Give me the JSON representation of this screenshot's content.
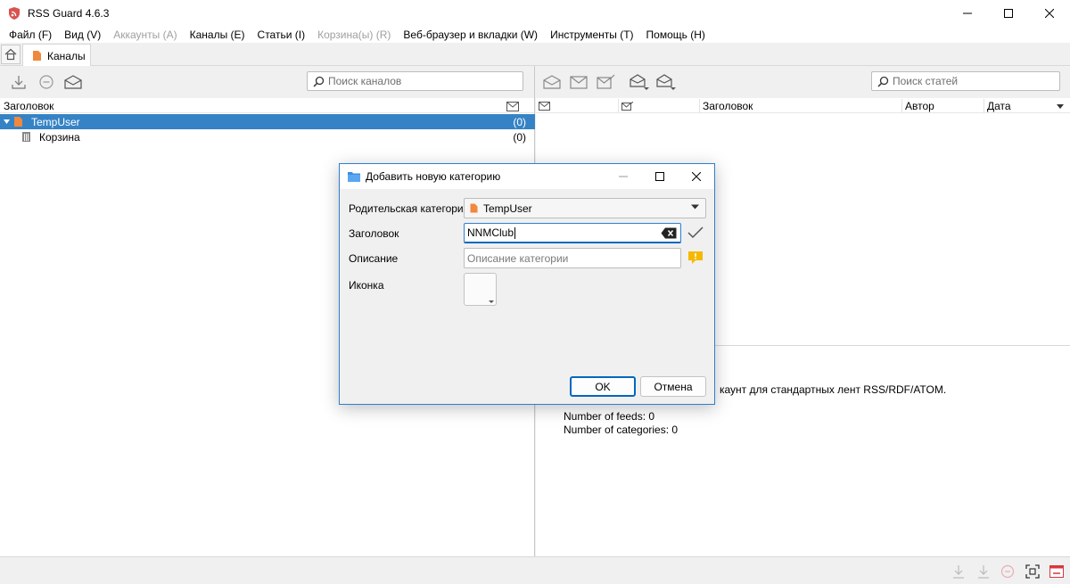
{
  "window": {
    "title": "RSS Guard 4.6.3"
  },
  "menu": [
    {
      "label": "Файл (F)",
      "enabled": true
    },
    {
      "label": "Вид (V)",
      "enabled": true
    },
    {
      "label": "Аккаунты (A)",
      "enabled": false
    },
    {
      "label": "Каналы (E)",
      "enabled": true
    },
    {
      "label": "Статьи (I)",
      "enabled": true
    },
    {
      "label": "Корзина(ы) (R)",
      "enabled": false
    },
    {
      "label": "Веб-браузер и вкладки (W)",
      "enabled": true
    },
    {
      "label": "Инструменты (T)",
      "enabled": true
    },
    {
      "label": "Помощь (H)",
      "enabled": true
    }
  ],
  "tabs": {
    "feeds_label": "Каналы"
  },
  "feeds_pane": {
    "search_placeholder": "Поиск каналов",
    "header_title": "Заголовок",
    "tree": [
      {
        "label": "TempUser",
        "count": "(0)",
        "selected": true
      },
      {
        "label": "Корзина",
        "count": "(0)",
        "selected": false
      }
    ]
  },
  "messages_pane": {
    "search_placeholder": "Поиск статей",
    "headers": {
      "title": "Заголовок",
      "author": "Автор",
      "date": "Дата"
    }
  },
  "preview": {
    "account_line": "каунт для стандартных лент RSS/RDF/ATOM.",
    "feeds_count": "Number of feeds: 0",
    "categories_count": "Number of categories: 0"
  },
  "dialog": {
    "title": "Добавить новую категорию",
    "parent_label": "Родительская категория",
    "parent_value": "TempUser",
    "title_label": "Заголовок",
    "title_value": "NNMClub",
    "description_label": "Описание",
    "description_placeholder": "Описание категории",
    "icon_label": "Иконка",
    "ok_label": "OK",
    "cancel_label": "Отмена"
  },
  "colors": {
    "accent": "#0067c0",
    "selection": "#3583c5",
    "folder": "#f0883e",
    "warning": "#f5b800"
  }
}
